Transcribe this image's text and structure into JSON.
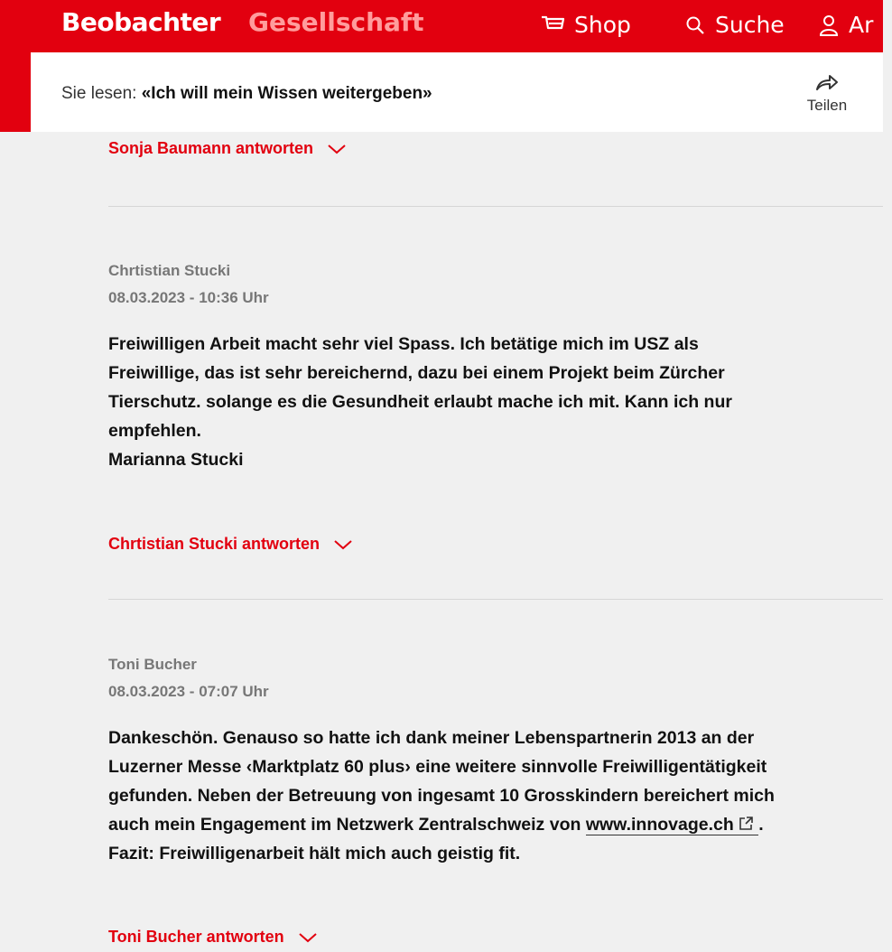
{
  "header": {
    "brand": "Beobachter",
    "section": "Gesellschaft",
    "nav": [
      {
        "label": "Shop",
        "icon": "cart-icon"
      },
      {
        "label": "Suche",
        "icon": "search-icon"
      },
      {
        "label": "Ar",
        "icon": "user-icon"
      }
    ],
    "colors": {
      "brand_red": "#e2000f",
      "section_pink": "#ff9c9c"
    }
  },
  "reading_bar": {
    "prefix": "Sie lesen:",
    "title": "«Ich will mein Wissen weitergeben»",
    "share_label": "Teilen",
    "share_icon": "share-arrow-icon"
  },
  "comments": [
    {
      "reply_label": "Sonja Baumann antworten"
    },
    {
      "author": "Chrtistian Stucki",
      "date": "08.03.2023 - 10:36 Uhr",
      "lines": [
        "Freiwilligen Arbeit macht sehr viel Spass. Ich betätige mich im USZ als",
        "Freiwillige, das ist sehr bereichernd, dazu bei einem Projekt beim Zürcher",
        "Tierschutz. solange es die Gesundheit erlaubt mache ich mit. Kann ich nur",
        "empfehlen.",
        "Marianna Stucki"
      ],
      "reply_label": "Chrtistian Stucki antworten"
    },
    {
      "author": "Toni Bucher",
      "date": "08.03.2023 - 07:07 Uhr",
      "lines": [
        "Dankeschön. Genauso so hatte ich dank meiner Lebenspartnerin 2013 an der",
        "Luzerner Messe ‹Marktplatz 60 plus› eine weitere sinnvolle Freiwilligentätigkeit",
        "gefunden. Neben der Betreuung von ingesamt 10 Grosskindern bereichert mich"
      ],
      "line4_prefix": "auch mein Engagement im Netzwerk Zentralschweiz von",
      "link_text": "www.innovage.ch",
      "line4_suffix": ".",
      "line5": "Fazit: Freiwilligenarbeit hält mich auch geistig fit.",
      "reply_label": "Toni Bucher antworten"
    }
  ]
}
